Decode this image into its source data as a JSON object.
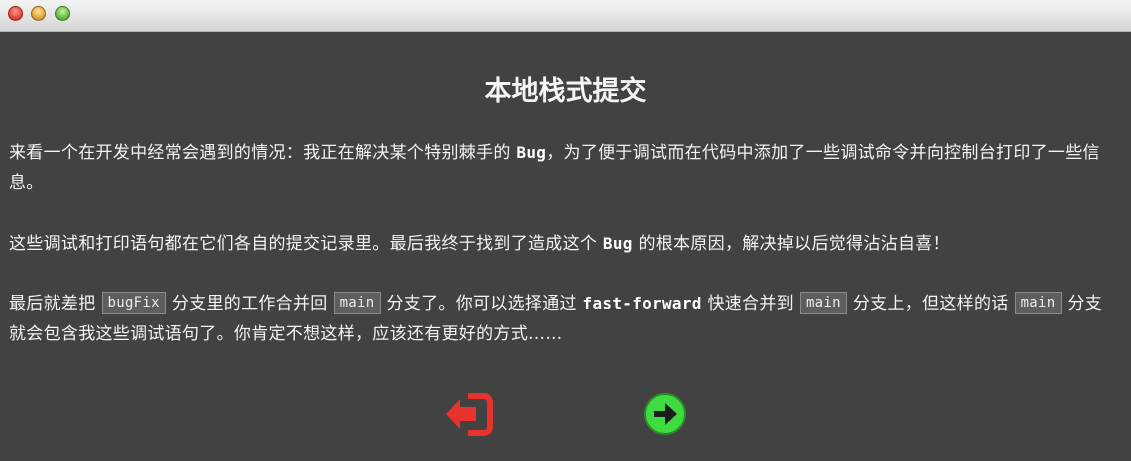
{
  "window": {
    "controls": [
      "close",
      "minimize",
      "maximize"
    ]
  },
  "dialog": {
    "title": "本地栈式提交",
    "p1": {
      "t1": "来看一个在开发中经常会遇到的情况：我正在解决某个特别棘手的",
      "code1": "Bug",
      "t2": "，为了便于调试而在代码中添加了一些调试命令并向控制台打印了一些信息。"
    },
    "p2": {
      "t1": "这些调试和打印语句都在它们各自的提交记录里。最后我终于找到了造成这个",
      "code1": "Bug",
      "t2": "的根本原因，解决掉以后觉得沾沾自喜！"
    },
    "p3": {
      "t1": "最后就差把",
      "chip1": "bugFix",
      "t2": "分支里的工作合并回",
      "chip2": "main",
      "t3": "分支了。你可以选择通过",
      "code1": "fast-forward",
      "t4": "快速合并到",
      "chip3": "main",
      "t5": "分支上，但这样的话",
      "chip4": "main",
      "t6": "分支就会包含我这些调试语句了。你肯定不想这样，应该还有更好的方式……"
    }
  },
  "nav": {
    "back_icon": "exit-arrow-left-icon",
    "next_icon": "arrow-right-circle-icon",
    "colors": {
      "back": "#e8322c",
      "next": "#3fdc3f"
    }
  }
}
